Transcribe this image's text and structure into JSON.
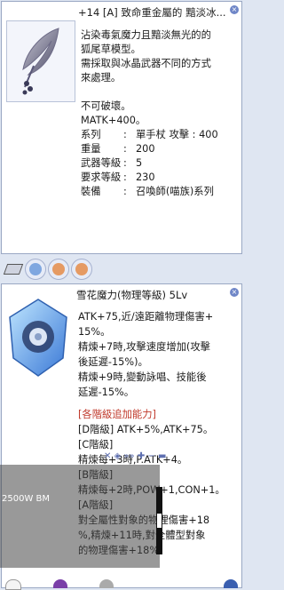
{
  "card1": {
    "title": "+14 [A] 致命重金屬的 黯淡冰...",
    "desc_lines": [
      "沾染毒氣魔力且黯淡無光的的",
      "狐尾草模型。",
      "需採取與冰晶武器不同的方式",
      "來處理。"
    ],
    "unbreakable": "不可破壞。",
    "matk": "MATK+400。",
    "stats": [
      {
        "k": "系列",
        "v": "單手杖 攻擊 : 400"
      },
      {
        "k": "重量",
        "v": "200"
      },
      {
        "k": "武器等級",
        "v": "5"
      },
      {
        "k": "要求等級",
        "v": "230"
      },
      {
        "k": "裝備",
        "v": "召喚師(喵族)系列"
      }
    ]
  },
  "card2": {
    "title": "雪花魔力(物理等級) 5Lv",
    "lines": [
      "ATK+75,近/遠距離物理傷害+",
      "15%。",
      "精煉+7時,攻擊速度增加(攻擊",
      "後延遲-15%)。",
      "精煉+9時,變動詠唱、技能後",
      "延遲-15%。"
    ],
    "bonus_header": "[各階級追加能力]",
    "bonus_lines": [
      "[D階級] ATK+5%,ATK+75。",
      "[C階級]",
      " 精煉每+3時,P.ATK+4。",
      "[B階級]",
      " 精煉每+2時,POW+1,CON+1。",
      "[A階級]",
      " 對全屬性對象的物理傷害+18",
      "%,精煉+11時,對全體型對象",
      "的物理傷害+18%。"
    ]
  },
  "overlay": {
    "text": "2500W BM",
    "mini": "✕ ◈ »» ✚ − ▬"
  },
  "close_glyph": "×",
  "colors": {
    "accent": "#6f86c7",
    "bonus": "#c0392b",
    "bar": "#dfe6f2"
  }
}
